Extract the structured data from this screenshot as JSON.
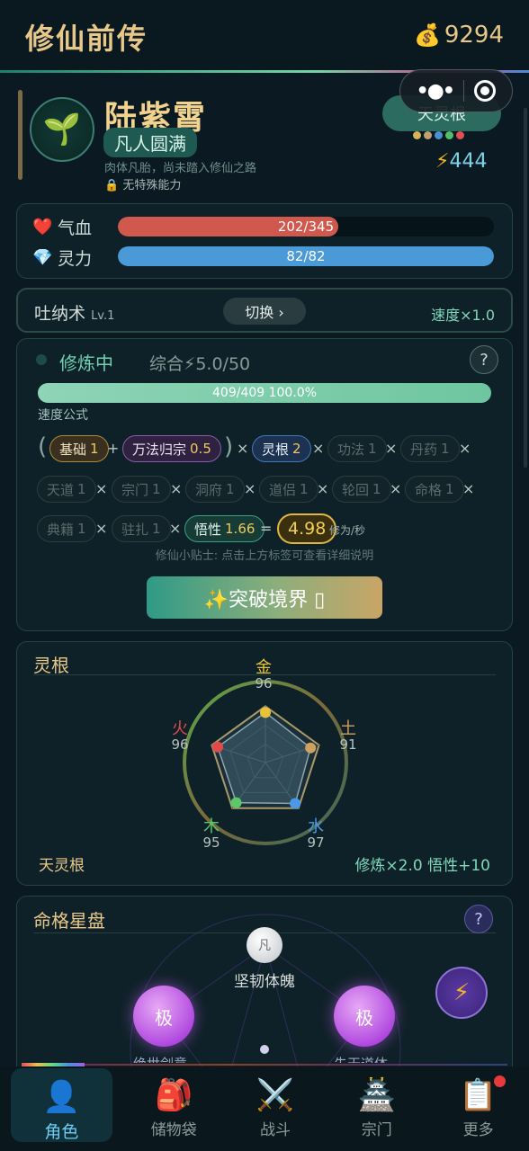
{
  "header": {
    "title": "修仙前传",
    "money": "9294"
  },
  "character": {
    "name": "陆紫霄",
    "realm": "凡人圆满",
    "realm_desc": "肉体凡胎，尚未踏入修仙之路",
    "ability": "无特殊能力",
    "root_badge": "天灵根",
    "root_dot_colors": [
      "#d4b35a",
      "#c0a070",
      "#4a8fd0",
      "#4fc06a",
      "#e05050"
    ],
    "power": "444"
  },
  "stats": {
    "hp": {
      "label": "气血",
      "value": "202/345",
      "ratio": 0.5855,
      "color": "#d0584c",
      "icon": "heart-icon"
    },
    "mp": {
      "label": "灵力",
      "value": "82/82",
      "ratio": 1.0,
      "color": "#4a9ad8",
      "icon": "diamond-icon"
    }
  },
  "technique": {
    "name": "吐纳术",
    "level": "Lv.1",
    "switch_label": "切换 ›",
    "speed": "速度×1.0"
  },
  "cultivation": {
    "status": "修炼中",
    "total": "综合⚡5.0/50",
    "progress_text": "409/409  100.0%",
    "progress_ratio": 1.0,
    "formula_label": "速度公式",
    "chips": {
      "base": {
        "label": "基础",
        "value": "1"
      },
      "wanfa": {
        "label": "万法归宗",
        "value": "0.5"
      },
      "linggen": {
        "label": "灵根",
        "value": "2"
      },
      "gongfa": {
        "label": "功法",
        "value": "1"
      },
      "danyao": {
        "label": "丹药",
        "value": "1"
      },
      "tiandao": {
        "label": "天道",
        "value": "1"
      },
      "zongmen": {
        "label": "宗门",
        "value": "1"
      },
      "dongfu": {
        "label": "洞府",
        "value": "1"
      },
      "daolv": {
        "label": "道侣",
        "value": "1"
      },
      "lunhui": {
        "label": "轮回",
        "value": "1"
      },
      "mingge": {
        "label": "命格",
        "value": "1"
      },
      "dianji": {
        "label": "典籍",
        "value": "1"
      },
      "zhuzha": {
        "label": "驻扎",
        "value": "1"
      },
      "wuxing": {
        "label": "悟性",
        "value": "1.66"
      }
    },
    "result": "4.98",
    "result_unit": "修为/秒",
    "tip": "修仙小贴士: 点击上方标签可查看详细说明",
    "breakthrough_label": "✨突破境界 ▯"
  },
  "roots": {
    "title": "灵根",
    "type": "天灵根",
    "bonus": "修炼×2.0  悟性+10",
    "elements": {
      "gold": {
        "name": "金",
        "value": "96",
        "level": 96,
        "color": "#e8c23a"
      },
      "earth": {
        "name": "土",
        "value": "91",
        "level": 91,
        "color": "#d0a060"
      },
      "water": {
        "name": "水",
        "value": "97",
        "level": 97,
        "color": "#4a9ae8"
      },
      "wood": {
        "name": "木",
        "value": "95",
        "level": 95,
        "color": "#5cc86a"
      },
      "fire": {
        "name": "火",
        "value": "96",
        "level": 96,
        "color": "#e04a4a"
      }
    }
  },
  "destiny": {
    "title": "命格星盘",
    "center_char": "凡",
    "center_label": "坚韧体魄",
    "left_orb": "极",
    "right_orb": "极",
    "left_cut": "绝世剑意",
    "right_cut": "先天道体"
  },
  "nav": {
    "items": [
      {
        "label": "角色",
        "icon": "person-icon"
      },
      {
        "label": "储物袋",
        "icon": "backpack-icon"
      },
      {
        "label": "战斗",
        "icon": "crossed-swords-icon"
      },
      {
        "label": "宗门",
        "icon": "pagoda-icon"
      },
      {
        "label": "更多",
        "icon": "clipboard-icon"
      }
    ]
  }
}
